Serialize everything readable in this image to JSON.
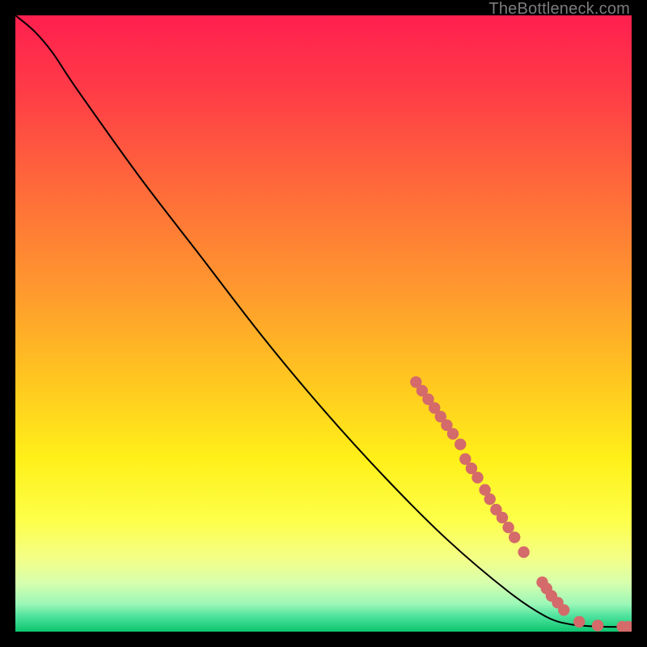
{
  "credit": "TheBottleneck.com",
  "chart_data": {
    "type": "line",
    "title": "",
    "xlabel": "",
    "ylabel": "",
    "xlim": [
      0,
      100
    ],
    "ylim": [
      0,
      100
    ],
    "curve": [
      {
        "x": 0.0,
        "y": 100.0
      },
      {
        "x": 3.0,
        "y": 97.5
      },
      {
        "x": 6.0,
        "y": 94.0
      },
      {
        "x": 10.0,
        "y": 88.0
      },
      {
        "x": 20.0,
        "y": 74.0
      },
      {
        "x": 30.0,
        "y": 61.0
      },
      {
        "x": 40.0,
        "y": 48.0
      },
      {
        "x": 50.0,
        "y": 36.0
      },
      {
        "x": 60.0,
        "y": 25.0
      },
      {
        "x": 70.0,
        "y": 15.0
      },
      {
        "x": 80.0,
        "y": 6.5
      },
      {
        "x": 86.0,
        "y": 2.5
      },
      {
        "x": 90.0,
        "y": 1.2
      },
      {
        "x": 95.0,
        "y": 0.8
      },
      {
        "x": 100.0,
        "y": 0.8
      }
    ],
    "highlight_points": [
      {
        "x": 65.0,
        "y": 40.5
      },
      {
        "x": 66.0,
        "y": 39.1
      },
      {
        "x": 67.0,
        "y": 37.7
      },
      {
        "x": 68.0,
        "y": 36.3
      },
      {
        "x": 69.0,
        "y": 34.9
      },
      {
        "x": 70.0,
        "y": 33.5
      },
      {
        "x": 71.0,
        "y": 32.1
      },
      {
        "x": 72.2,
        "y": 30.4
      },
      {
        "x": 73.0,
        "y": 28.0
      },
      {
        "x": 74.0,
        "y": 26.5
      },
      {
        "x": 75.0,
        "y": 25.0
      },
      {
        "x": 76.2,
        "y": 23.0
      },
      {
        "x": 77.0,
        "y": 21.5
      },
      {
        "x": 78.0,
        "y": 19.8
      },
      {
        "x": 79.0,
        "y": 18.5
      },
      {
        "x": 80.0,
        "y": 16.9
      },
      {
        "x": 81.0,
        "y": 15.3
      },
      {
        "x": 82.5,
        "y": 12.9
      },
      {
        "x": 85.5,
        "y": 8.0
      },
      {
        "x": 86.2,
        "y": 7.0
      },
      {
        "x": 87.0,
        "y": 5.8
      },
      {
        "x": 88.0,
        "y": 4.7
      },
      {
        "x": 89.0,
        "y": 3.5
      },
      {
        "x": 91.5,
        "y": 1.6
      },
      {
        "x": 94.5,
        "y": 1.0
      },
      {
        "x": 98.5,
        "y": 0.8
      },
      {
        "x": 99.5,
        "y": 0.8
      }
    ],
    "gradient_stops": [
      {
        "pct": 0,
        "color": "#ff1f4f"
      },
      {
        "pct": 12,
        "color": "#ff3b47"
      },
      {
        "pct": 28,
        "color": "#ff6a3a"
      },
      {
        "pct": 45,
        "color": "#ff9a2e"
      },
      {
        "pct": 60,
        "color": "#ffc91f"
      },
      {
        "pct": 72,
        "color": "#fff019"
      },
      {
        "pct": 82,
        "color": "#fdff4a"
      },
      {
        "pct": 88,
        "color": "#f4ff86"
      },
      {
        "pct": 92,
        "color": "#d8ffad"
      },
      {
        "pct": 95.5,
        "color": "#9cf7b7"
      },
      {
        "pct": 97.5,
        "color": "#4fe29d"
      },
      {
        "pct": 100,
        "color": "#0cc66f"
      }
    ],
    "marker_color": "#d46a6a",
    "line_color": "#000000"
  }
}
